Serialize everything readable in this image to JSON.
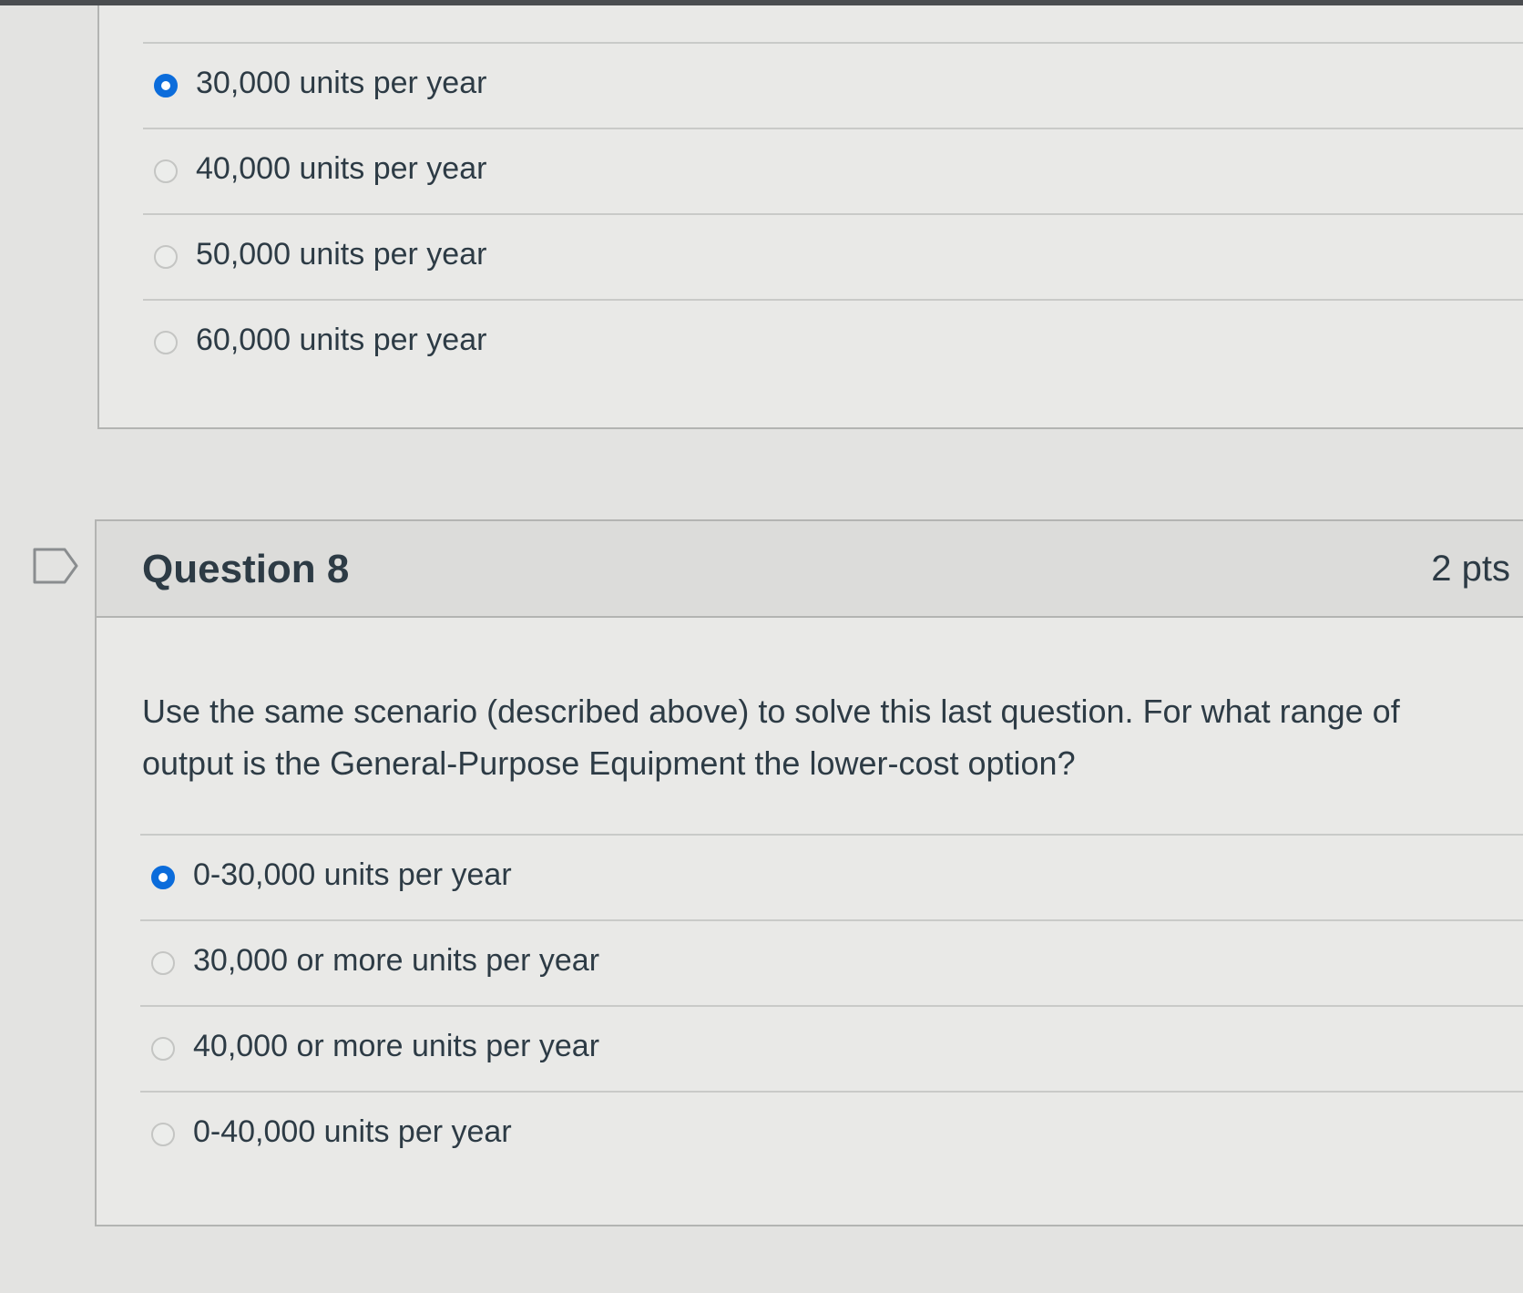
{
  "previous_question": {
    "answers": [
      {
        "label": "30,000 units per year",
        "selected": true
      },
      {
        "label": "40,000 units per year",
        "selected": false
      },
      {
        "label": "50,000 units per year",
        "selected": false
      },
      {
        "label": "60,000 units per year",
        "selected": false
      }
    ]
  },
  "question": {
    "title": "Question 8",
    "points": "2 pts",
    "text": "Use the same scenario (described above) to solve this last question. For what range of output is the General-Purpose Equipment the lower-cost option?",
    "answers": [
      {
        "label": "0-30,000 units per year",
        "selected": true
      },
      {
        "label": "30,000 or more units per year",
        "selected": false
      },
      {
        "label": "40,000 or more units per year",
        "selected": false
      },
      {
        "label": "0-40,000 units per year",
        "selected": false
      }
    ]
  },
  "colors": {
    "selected_radio": "#0b6cdb",
    "text": "#2d3b45",
    "background": "#e9e9e7"
  }
}
